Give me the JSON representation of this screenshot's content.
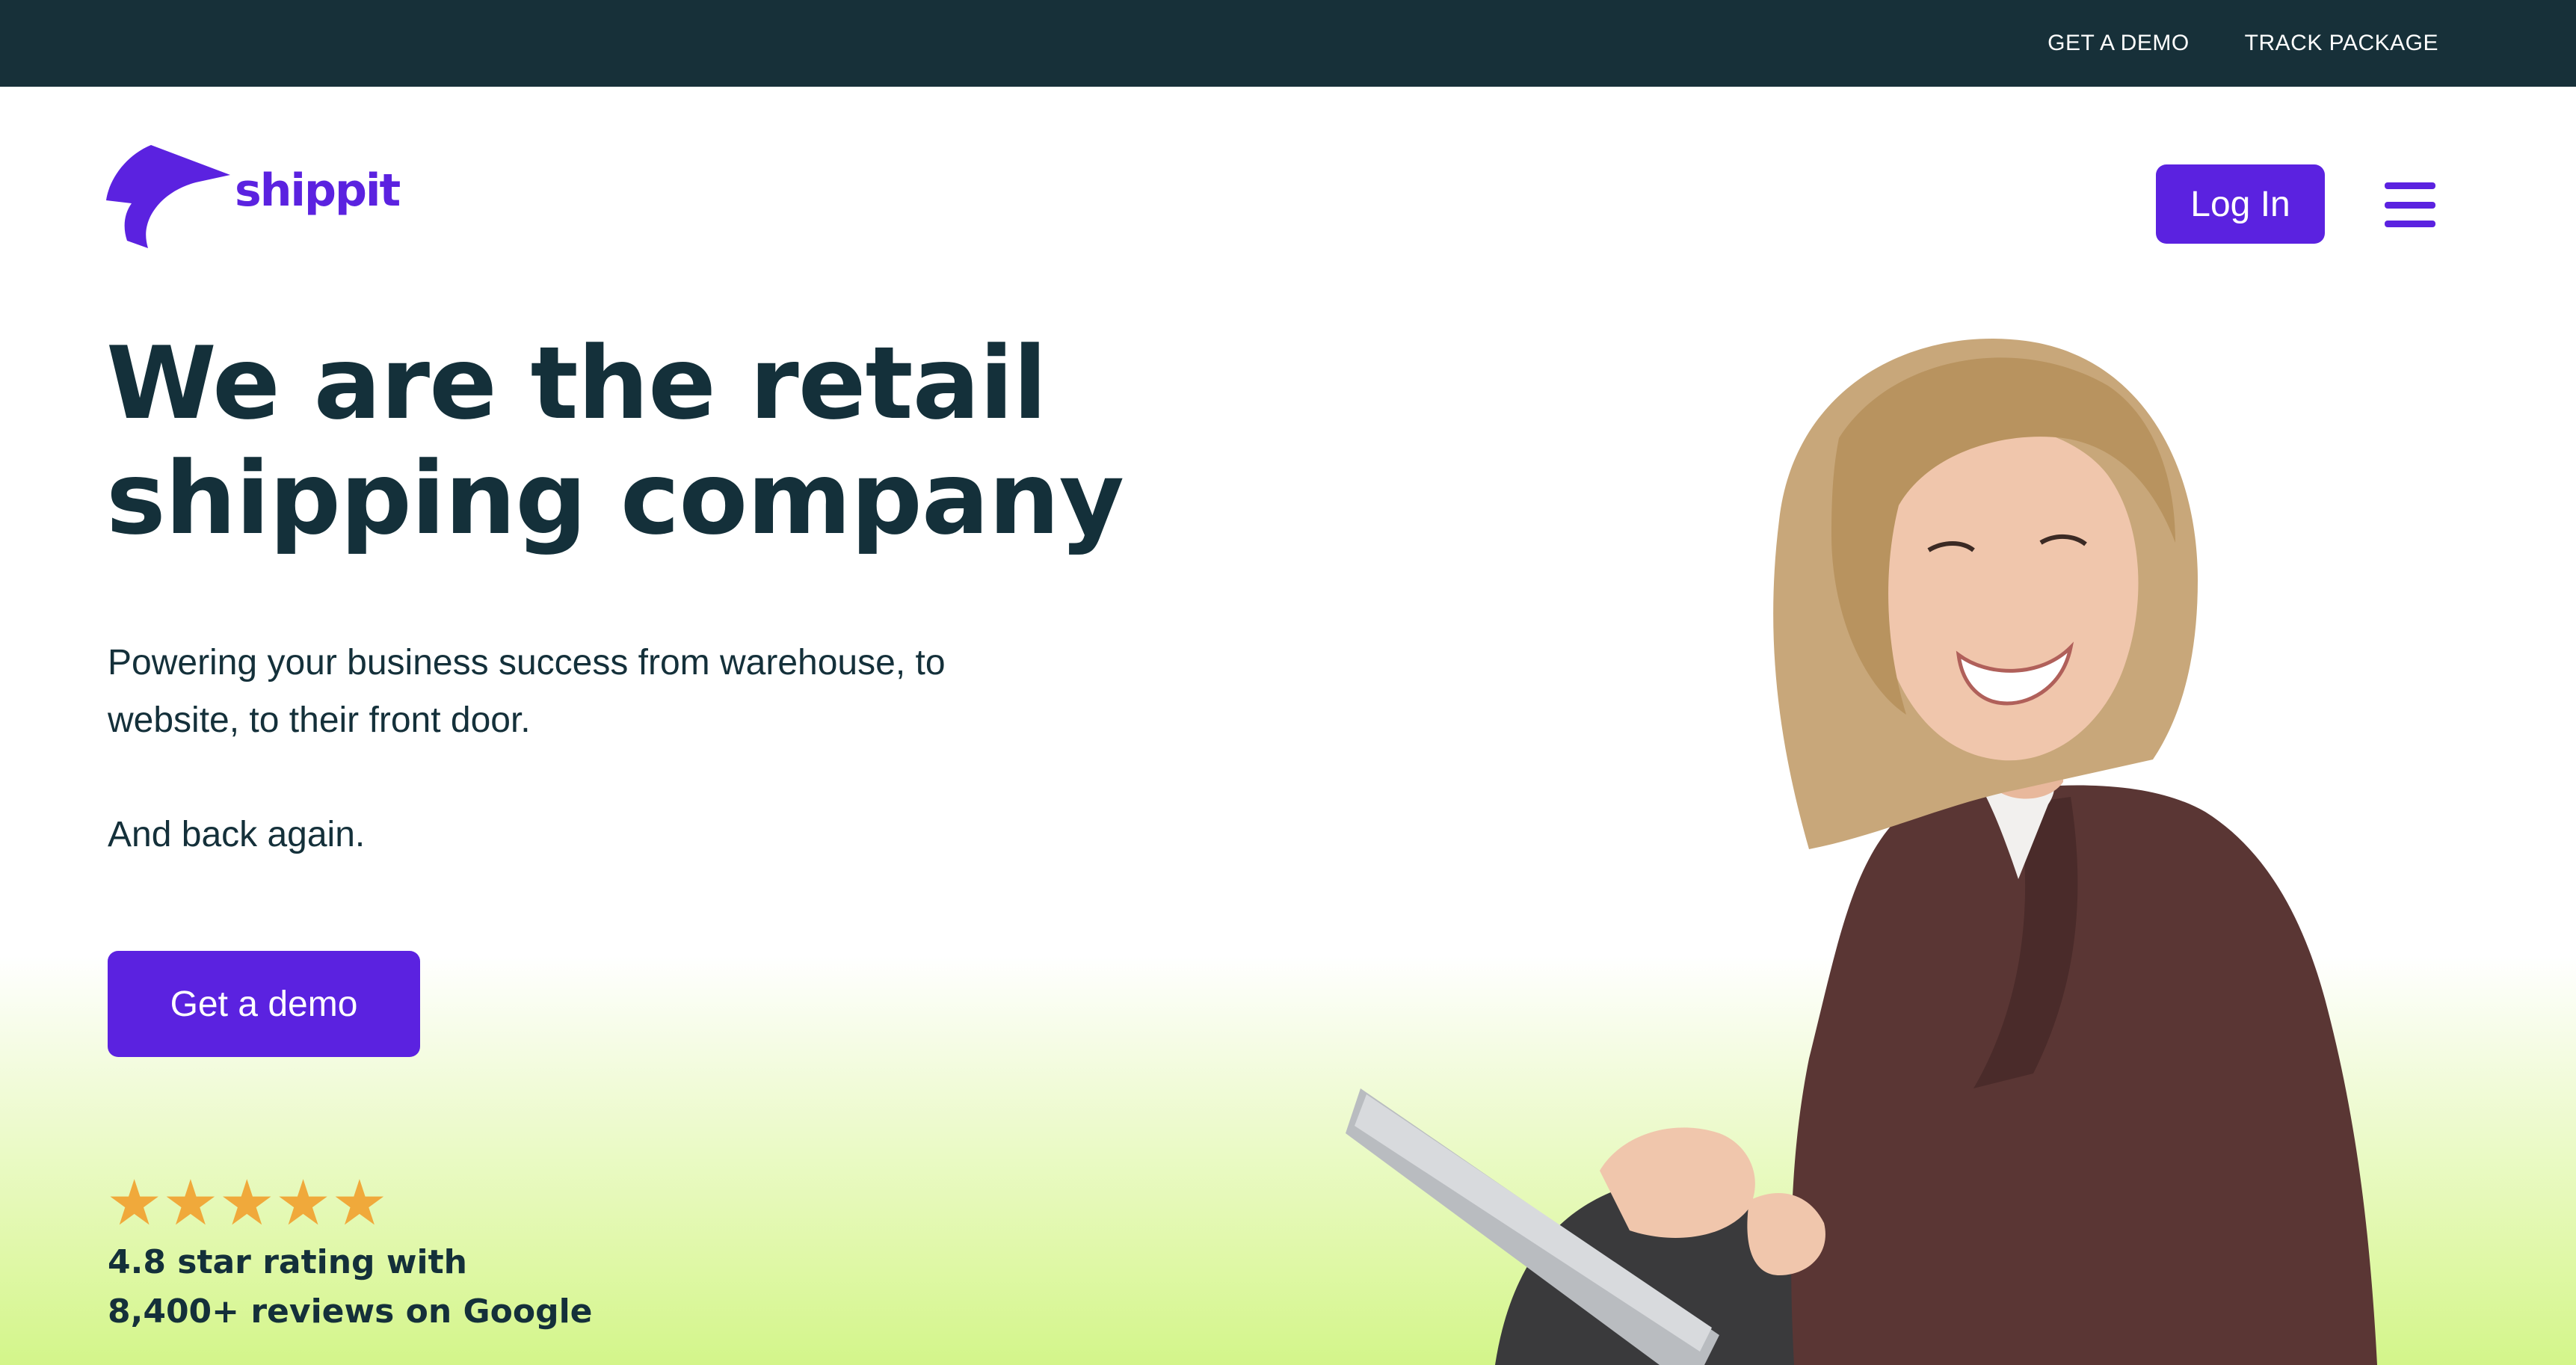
{
  "topbar": {
    "links": [
      "GET A DEMO",
      "TRACK PACKAGE"
    ]
  },
  "header": {
    "logo_text": "shippit",
    "login_label": "Log In",
    "menu_icon": "hamburger-icon"
  },
  "hero": {
    "headline_line1": "We are the retail",
    "headline_line2": "shipping company",
    "subtitle_line1": "Powering your business success from warehouse, to",
    "subtitle_line2": "website, to their front door.",
    "subtitle2": "And back again.",
    "cta_label": "Get a demo",
    "stars": "★★★★★",
    "rating_value": 5,
    "rating_line1": "4.8 star rating with",
    "rating_line2": "8,400+ reviews on Google"
  },
  "colors": {
    "topbar_bg": "#173039",
    "brand_purple": "#5b22e0",
    "text_dark": "#14303a",
    "star": "#f0a93b",
    "gradient_green": "#d3f58a"
  }
}
